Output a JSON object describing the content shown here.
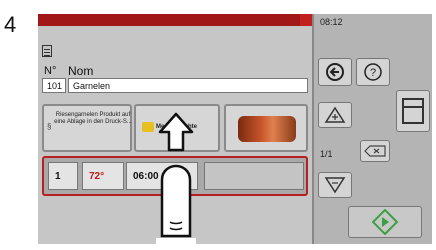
{
  "step_number": "4",
  "status": {
    "time": "08:12"
  },
  "form": {
    "number_label": "N°",
    "name_label": "Nom",
    "number_value": "101",
    "name_value": "Garnelen"
  },
  "products": [
    {
      "text": "Riesengarnelen Produkt auf eine Ablage in den Druck-S..."
    },
    {
      "text": "Meeresfrüchte"
    },
    {
      "text": ""
    }
  ],
  "program_row": {
    "slot": "1",
    "temperature": "72°",
    "time": "06:00"
  },
  "sidebar": {
    "page_indicator": "1/1"
  },
  "colors": {
    "topbar": "#a01818",
    "selection_border": "#b52020",
    "start_icon": "#3aa040"
  }
}
